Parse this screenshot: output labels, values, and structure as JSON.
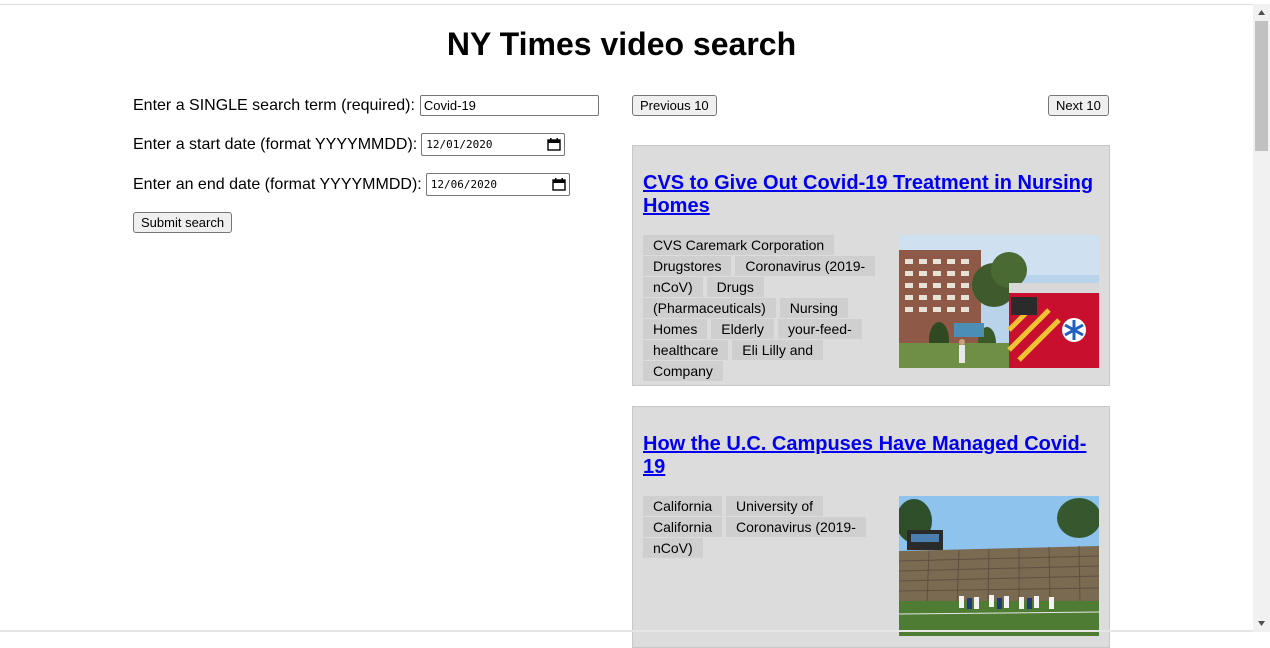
{
  "page": {
    "title": "NY Times video search"
  },
  "form": {
    "term_label": "Enter a SINGLE search term (required):",
    "term_value": "Covid-19",
    "start_label": "Enter a start date (format YYYYMMDD):",
    "start_value": "12/01/2020",
    "end_label": "Enter an end date (format YYYYMMDD):",
    "end_value": "12/06/2020",
    "submit_label": "Submit search"
  },
  "pager": {
    "prev_label": "Previous 10",
    "next_label": "Next 10"
  },
  "results": [
    {
      "title": "CVS to Give Out Covid-19 Treatment in Nursing Homes",
      "tags": [
        "CVS Caremark Corporation",
        "Drugstores",
        "Coronavirus (2019-nCoV)",
        "Drugs (Pharmaceuticals)",
        "Nursing Homes",
        "Elderly",
        "your-feed-healthcare",
        "Eli Lilly and Company"
      ],
      "image": "ambulance-outside-nursing-home"
    },
    {
      "title": "How the U.C. Campuses Have Managed Covid-19",
      "tags": [
        "California",
        "University of California",
        "Coronavirus (2019-nCoV)"
      ],
      "image": "football-stadium"
    }
  ],
  "icons": {
    "calendar": "calendar-icon",
    "scroll_up": "arrow-up-icon",
    "scroll_down": "arrow-down-icon"
  },
  "colors": {
    "link": "#0000ee",
    "card_bg": "#dcdcdc",
    "tag_bg": "#cfcfcf"
  }
}
